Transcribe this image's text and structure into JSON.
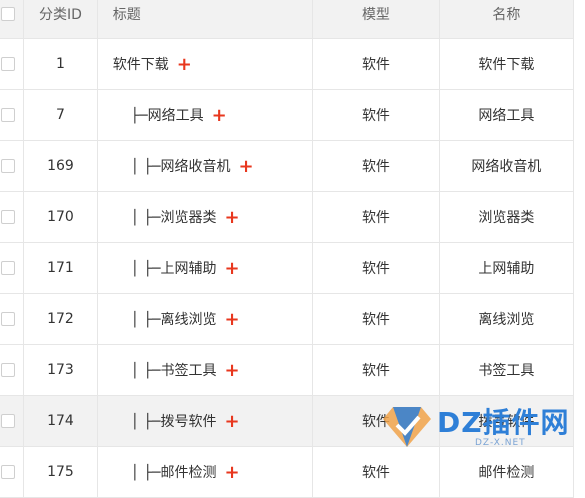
{
  "table": {
    "headers": {
      "category_id": "分类ID",
      "title": "标题",
      "model": "模型",
      "name": "名称"
    },
    "rows": [
      {
        "id": "1",
        "prefix": "",
        "title": "软件下载",
        "model": "软件",
        "name": "软件下载"
      },
      {
        "id": "7",
        "prefix": "├─ ",
        "title": "网络工具",
        "model": "软件",
        "name": "网络工具"
      },
      {
        "id": "169",
        "prefix": "│  ├─ ",
        "title": "网络收音机",
        "model": "软件",
        "name": "网络收音机"
      },
      {
        "id": "170",
        "prefix": "│  ├─ ",
        "title": "浏览器类",
        "model": "软件",
        "name": "浏览器类"
      },
      {
        "id": "171",
        "prefix": "│  ├─ ",
        "title": "上网辅助",
        "model": "软件",
        "name": "上网辅助"
      },
      {
        "id": "172",
        "prefix": "│  ├─ ",
        "title": "离线浏览",
        "model": "软件",
        "name": "离线浏览"
      },
      {
        "id": "173",
        "prefix": "│  ├─ ",
        "title": "书签工具",
        "model": "软件",
        "name": "书签工具"
      },
      {
        "id": "174",
        "prefix": "│  ├─ ",
        "title": "拨号软件",
        "model": "软件",
        "name": "拨号软件"
      },
      {
        "id": "175",
        "prefix": "│  ├─ ",
        "title": "邮件检测",
        "model": "软件",
        "name": "邮件检测"
      }
    ],
    "add_symbol": "+"
  },
  "watermark": {
    "text": "DZ插件网",
    "sub": "DZ-X.NET"
  },
  "colors": {
    "plus": "#e8371e",
    "header_bg": "#f2f2f2",
    "border": "#e6e6e6"
  }
}
